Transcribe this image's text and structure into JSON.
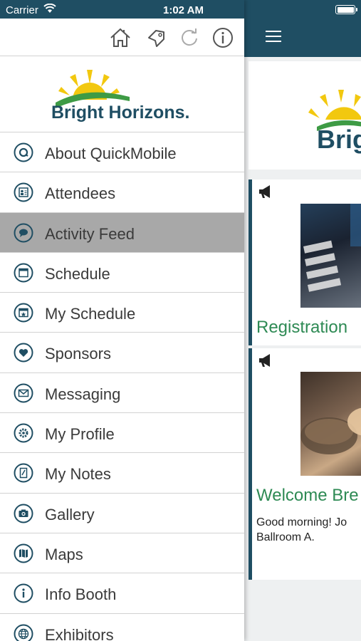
{
  "status_bar": {
    "carrier": "Carrier",
    "time": "1:02 AM"
  },
  "toolbar": {
    "icons": [
      "home-icon",
      "bookmark-icon",
      "refresh-icon",
      "info-icon"
    ]
  },
  "logo": {
    "text": "Bright Horizons.",
    "brand_color": "#1f4e63",
    "sun_color": "#f2c80f",
    "hill_color": "#3e9b45"
  },
  "menu": {
    "items": [
      {
        "label": "About QuickMobile",
        "icon": "quickmobile-icon"
      },
      {
        "label": "Attendees",
        "icon": "attendees-icon"
      },
      {
        "label": "Activity Feed",
        "icon": "chat-bubble-icon",
        "active": true
      },
      {
        "label": "Schedule",
        "icon": "calendar-icon"
      },
      {
        "label": "My Schedule",
        "icon": "my-calendar-icon"
      },
      {
        "label": "Sponsors",
        "icon": "heart-icon"
      },
      {
        "label": "Messaging",
        "icon": "envelope-icon"
      },
      {
        "label": "My Profile",
        "icon": "gear-icon"
      },
      {
        "label": "My Notes",
        "icon": "notes-icon"
      },
      {
        "label": "Gallery",
        "icon": "camera-icon"
      },
      {
        "label": "Maps",
        "icon": "map-icon"
      },
      {
        "label": "Info Booth",
        "icon": "info-icon"
      },
      {
        "label": "Exhibitors",
        "icon": "globe-icon"
      }
    ]
  },
  "main": {
    "logo_partial": "Brig",
    "cards": [
      {
        "title": "Registration",
        "icon": "megaphone-icon"
      },
      {
        "title": "Welcome Bre",
        "icon": "megaphone-icon",
        "body_line1": "Good morning! Jo",
        "body_line2": "Ballroom A."
      }
    ]
  },
  "colors": {
    "primary": "#1f4e63",
    "accent_green": "#2e8a54",
    "active_row": "#a8a8a8"
  }
}
